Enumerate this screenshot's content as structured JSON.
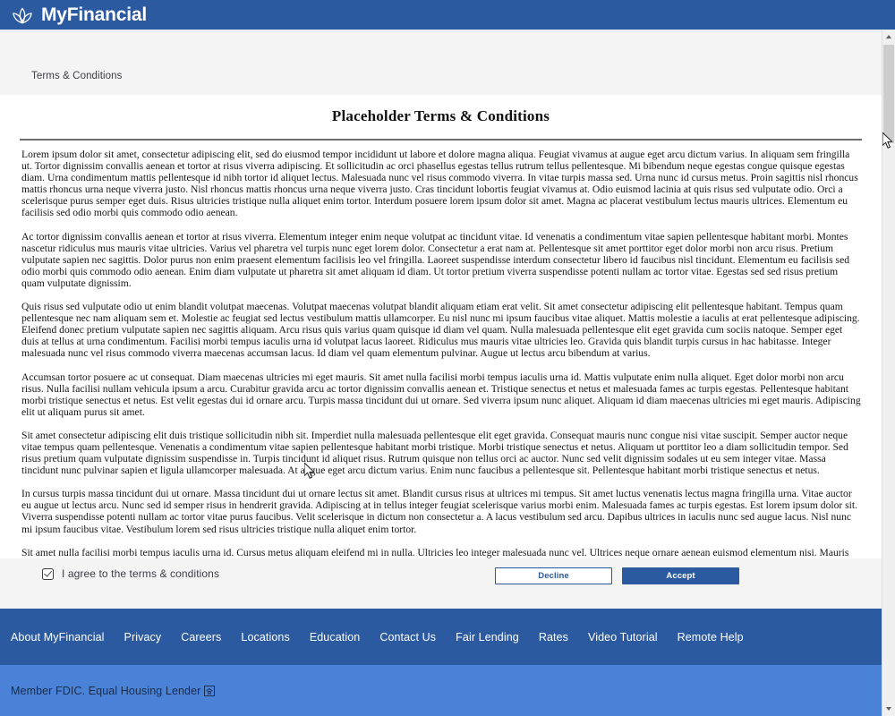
{
  "header": {
    "brand": "MyFinancial",
    "logo_icon": "lotus-flower-icon",
    "bg_color": "#2c5aa0"
  },
  "breadcrumb": {
    "text": "Terms & Conditions"
  },
  "document": {
    "title": "Placeholder Terms & Conditions",
    "paragraphs": [
      "Lorem ipsum dolor sit amet, consectetur adipiscing elit, sed do eiusmod tempor incididunt ut labore et dolore magna aliqua. Feugiat vivamus at augue eget arcu dictum varius. In aliquam sem fringilla ut. Tortor dignissim convallis aenean et tortor at risus viverra adipiscing. Et sollicitudin ac orci phasellus egestas tellus rutrum tellus pellentesque. Mi bibendum neque egestas congue quisque egestas diam. Urna condimentum mattis pellentesque id nibh tortor id aliquet lectus. Malesuada nunc vel risus commodo viverra. In vitae turpis massa sed. Urna nunc id cursus metus. Proin sagittis nisl rhoncus mattis rhoncus urna neque viverra justo. Nisl rhoncus mattis rhoncus urna neque viverra justo. Cras tincidunt lobortis feugiat vivamus at. Odio euismod lacinia at quis risus sed vulputate odio. Orci a scelerisque purus semper eget duis. Risus ultricies tristique nulla aliquet enim tortor. Interdum posuere lorem ipsum dolor sit amet. Magna ac placerat vestibulum lectus mauris ultrices. Elementum eu facilisis sed odio morbi quis commodo odio aenean.",
      "Ac tortor dignissim convallis aenean et tortor at risus viverra. Elementum integer enim neque volutpat ac tincidunt vitae. Id venenatis a condimentum vitae sapien pellentesque habitant morbi. Montes nascetur ridiculus mus mauris vitae ultricies. Varius vel pharetra vel turpis nunc eget lorem dolor. Consectetur a erat nam at. Pellentesque sit amet porttitor eget dolor morbi non arcu risus. Pretium vulputate sapien nec sagittis. Dolor purus non enim praesent elementum facilisis leo vel fringilla. Laoreet suspendisse interdum consectetur libero id faucibus nisl tincidunt. Elementum eu facilisis sed odio morbi quis commodo odio aenean. Enim diam vulputate ut pharetra sit amet aliquam id diam. Ut tortor pretium viverra suspendisse potenti nullam ac tortor vitae. Egestas sed sed risus pretium quam vulputate dignissim.",
      "Quis risus sed vulputate odio ut enim blandit volutpat maecenas. Volutpat maecenas volutpat blandit aliquam etiam erat velit. Sit amet consectetur adipiscing elit pellentesque habitant. Tempus quam pellentesque nec nam aliquam sem et. Molestie ac feugiat sed lectus vestibulum mattis ullamcorper. Eu nisl nunc mi ipsum faucibus vitae aliquet. Mattis molestie a iaculis at erat pellentesque adipiscing. Eleifend donec pretium vulputate sapien nec sagittis aliquam. Arcu risus quis varius quam quisque id diam vel quam. Nulla malesuada pellentesque elit eget gravida cum sociis natoque. Semper eget duis at tellus at urna condimentum. Facilisi morbi tempus iaculis urna id volutpat lacus laoreet. Ridiculus mus mauris vitae ultricies leo. Gravida quis blandit turpis cursus in hac habitasse. Integer malesuada nunc vel risus commodo viverra maecenas accumsan lacus. Id diam vel quam elementum pulvinar. Augue ut lectus arcu bibendum at varius.",
      "Accumsan tortor posuere ac ut consequat. Diam maecenas ultricies mi eget mauris. Sit amet nulla facilisi morbi tempus iaculis urna id. Mattis vulputate enim nulla aliquet. Eget dolor morbi non arcu risus. Nulla facilisi nullam vehicula ipsum a arcu. Curabitur gravida arcu ac tortor dignissim convallis aenean et. Tristique senectus et netus et malesuada fames ac turpis egestas. Pellentesque habitant morbi tristique senectus et netus. Est velit egestas dui id ornare arcu. Turpis massa tincidunt dui ut ornare. Sed viverra ipsum nunc aliquet. Aliquam id diam maecenas ultricies mi eget mauris. Adipiscing elit ut aliquam purus sit amet.",
      "Sit amet consectetur adipiscing elit duis tristique sollicitudin nibh sit. Imperdiet nulla malesuada pellentesque elit eget gravida. Consequat mauris nunc congue nisi vitae suscipit. Semper auctor neque vitae tempus quam pellentesque. Venenatis a condimentum vitae sapien pellentesque habitant morbi tristique. Morbi tristique senectus et netus. Aliquam ut porttitor leo a diam sollicitudin tempor. Sed risus pretium quam vulputate dignissim suspendisse in. Turpis tincidunt id aliquet risus. Rutrum quisque non tellus orci ac auctor. Nunc sed velit dignissim sodales ut eu sem integer vitae. Massa tincidunt nunc pulvinar sapien et ligula ullamcorper malesuada. At augue eget arcu dictum varius. Enim nunc faucibus a pellentesque sit. Pellentesque habitant morbi tristique senectus et netus.",
      "In cursus turpis massa tincidunt dui ut ornare. Massa tincidunt dui ut ornare lectus sit amet. Blandit cursus risus at ultrices mi tempus. Sit amet luctus venenatis lectus magna fringilla urna. Vitae auctor eu augue ut lectus arcu. Nunc sed id semper risus in hendrerit gravida. Adipiscing at in tellus integer feugiat scelerisque varius morbi enim. Malesuada fames ac turpis egestas. Est lorem ipsum dolor sit. Viverra suspendisse potenti nullam ac tortor vitae purus faucibus. Velit scelerisque in dictum non consectetur a. A lacus vestibulum sed arcu. Dapibus ultrices in iaculis nunc sed augue lacus. Nisl nunc mi ipsum faucibus vitae. Vestibulum lorem sed risus ultricies tristique nulla aliquet enim tortor.",
      "Sit amet nulla facilisi morbi tempus iaculis urna id. Cursus metus aliquam eleifend mi in nulla. Ultricies leo integer malesuada nunc vel. Ultrices neque ornare aenean euismod elementum nisi. Mauris pellentesque pulvinar pellentesque habitant morbi. Sem integer vitae justo eget magna fermentum iaculis. Bibendum at varius vel pharetra vel turpis. Neque aliquam vestibulum morbi blandit. Maecenas pharetra convallis posuere morbi leo. Elementum nibh tellus molestie nunc non blandit massa enim nec. Enim sed faucibus turpis in eu mi bibendum neque egestas."
    ]
  },
  "actions": {
    "agree_label": "I agree to the terms & conditions",
    "agree_checked": true,
    "decline_label": "Decline",
    "accept_label": "Accept",
    "accent_color": "#2c5aa0"
  },
  "footer": {
    "links": [
      "About MyFinancial",
      "Privacy",
      "Careers",
      "Locations",
      "Education",
      "Contact Us",
      "Fair Lending",
      "Rates",
      "Video Tutorial",
      "Remote Help"
    ],
    "legal_text": "Member FDIC.  Equal Housing Lender",
    "legal_icon": "equal-housing-lender-icon",
    "nav_bg_color": "#2c5aa0",
    "legal_bg_color": "#4a82d8"
  }
}
